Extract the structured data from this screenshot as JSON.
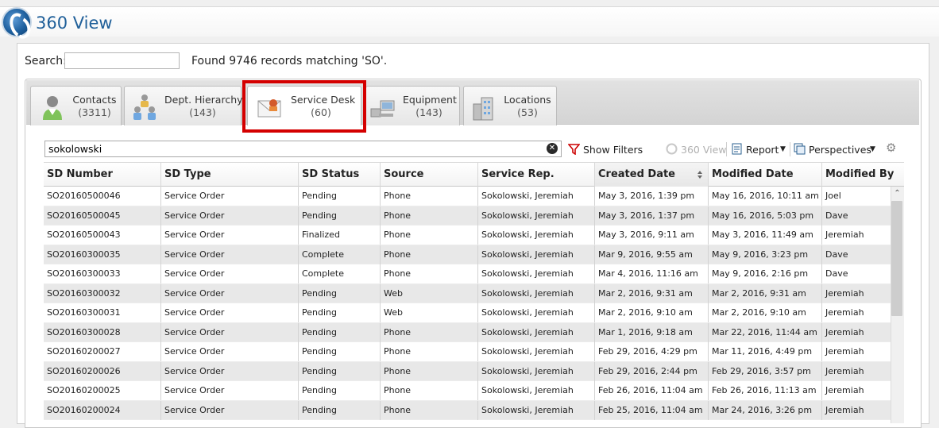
{
  "app": {
    "title": "360 View"
  },
  "search": {
    "label": "Search:",
    "value": "",
    "placeholder": "",
    "found_text": "Found 9746 records matching 'SO'."
  },
  "tabs": [
    {
      "label": "Contacts",
      "count": "(3311)",
      "icon": "contact-person-icon"
    },
    {
      "label": "Dept. Hierarchy",
      "count": "(143)",
      "icon": "hierarchy-people-icon"
    },
    {
      "label": "Service Desk",
      "count": "(60)",
      "icon": "service-desk-envelope-icon",
      "active": true
    },
    {
      "label": "Equipment",
      "count": "(143)",
      "icon": "computer-equipment-icon"
    },
    {
      "label": "Locations",
      "count": "(53)",
      "icon": "buildings-icon"
    }
  ],
  "toolbar": {
    "filter_value": "sokolowski",
    "show_filters": "Show Filters",
    "view_360": "360 View",
    "report": "Report",
    "perspectives": "Perspectives"
  },
  "grid": {
    "columns": [
      "SD Number",
      "SD Type",
      "SD Status",
      "Source",
      "Service Rep.",
      "Created Date",
      "Modified Date",
      "Modified By"
    ],
    "sorted_column": "Created Date",
    "rows": [
      [
        "SO20160500046",
        "Service Order",
        "Pending",
        "Phone",
        "Sokolowski, Jeremiah",
        "May 3, 2016, 1:39 pm",
        "May 16, 2016, 10:11 am",
        "Joel"
      ],
      [
        "SO20160500045",
        "Service Order",
        "Pending",
        "Phone",
        "Sokolowski, Jeremiah",
        "May 3, 2016, 1:37 pm",
        "May 16, 2016, 5:03 pm",
        "Dave"
      ],
      [
        "SO20160500043",
        "Service Order",
        "Finalized",
        "Phone",
        "Sokolowski, Jeremiah",
        "May 3, 2016, 9:11 am",
        "May 3, 2016, 11:49 am",
        "Jeremiah"
      ],
      [
        "SO20160300035",
        "Service Order",
        "Complete",
        "Phone",
        "Sokolowski, Jeremiah",
        "Mar 9, 2016, 9:55 am",
        "May 9, 2016, 3:23 pm",
        "Dave"
      ],
      [
        "SO20160300033",
        "Service Order",
        "Complete",
        "Phone",
        "Sokolowski, Jeremiah",
        "Mar 4, 2016, 11:16 am",
        "May 9, 2016, 2:16 pm",
        "Dave"
      ],
      [
        "SO20160300032",
        "Service Order",
        "Pending",
        "Web",
        "Sokolowski, Jeremiah",
        "Mar 2, 2016, 9:31 am",
        "Mar 2, 2016, 9:31 am",
        "Jeremiah"
      ],
      [
        "SO20160300031",
        "Service Order",
        "Pending",
        "Web",
        "Sokolowski, Jeremiah",
        "Mar 2, 2016, 9:10 am",
        "Mar 2, 2016, 9:10 am",
        "Jeremiah"
      ],
      [
        "SO20160300028",
        "Service Order",
        "Pending",
        "Phone",
        "Sokolowski, Jeremiah",
        "Mar 1, 2016, 9:18 am",
        "Mar 22, 2016, 11:44 am",
        "Jeremiah"
      ],
      [
        "SO20160200027",
        "Service Order",
        "Pending",
        "Phone",
        "Sokolowski, Jeremiah",
        "Feb 29, 2016, 4:29 pm",
        "Mar 11, 2016, 4:49 pm",
        "Jeremiah"
      ],
      [
        "SO20160200026",
        "Service Order",
        "Pending",
        "Phone",
        "Sokolowski, Jeremiah",
        "Feb 29, 2016, 2:44 pm",
        "Feb 29, 2016, 3:57 pm",
        "Jeremiah"
      ],
      [
        "SO20160200025",
        "Service Order",
        "Pending",
        "Phone",
        "Sokolowski, Jeremiah",
        "Feb 26, 2016, 11:04 am",
        "Feb 26, 2016, 11:13 am",
        "Jeremiah"
      ],
      [
        "SO20160200024",
        "Service Order",
        "Pending",
        "Phone",
        "Sokolowski, Jeremiah",
        "Feb 25, 2016, 11:04 am",
        "Mar 24, 2016, 3:26 pm",
        "Jeremiah"
      ]
    ]
  },
  "colors": {
    "accent": "#1f5f99",
    "highlight": "#d40000",
    "alt_row": "#e8e8e8"
  }
}
